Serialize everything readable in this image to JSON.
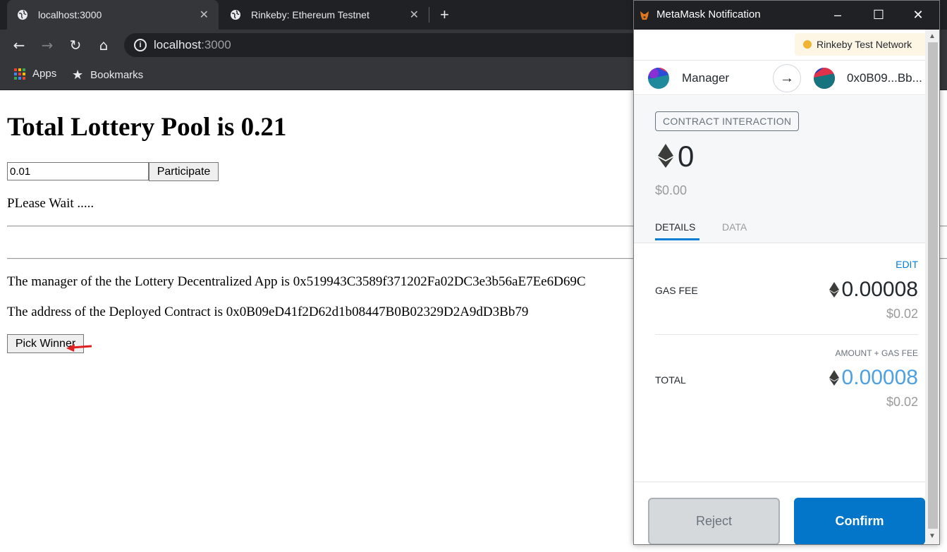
{
  "browser": {
    "tabs": [
      {
        "title": "localhost:3000",
        "active": true
      },
      {
        "title": "Rinkeby: Ethereum Testnet",
        "active": false
      }
    ],
    "address_bar": {
      "host": "localhost",
      "port": ":3000"
    },
    "bookmarks": [
      {
        "label": "Apps",
        "icon": "apps-grid-icon"
      },
      {
        "label": "Bookmarks",
        "icon": "star-icon"
      }
    ]
  },
  "page": {
    "pool_title": "Total Lottery Pool is 0.21",
    "amount_input_value": "0.01",
    "participate_label": "Participate",
    "wait_text": "PLease Wait .....",
    "manager_text": "The manager of the the Lottery Decentralized App is 0x519943C3589f371202Fa02DC3e3b56aE7Ee6D69C",
    "contract_text": "The address of the Deployed Contract is 0x0B09eD41f2D62d1b08447B0B02329D2A9dD3Bb79",
    "pick_winner_label": "Pick Winner"
  },
  "metamask": {
    "window_title": "MetaMask Notification",
    "network": "Rinkeby Test Network",
    "from_account": "Manager",
    "to_account": "0x0B09...Bb...",
    "badge": "CONTRACT INTERACTION",
    "amount": "0",
    "amount_fiat": "$0.00",
    "tabs": {
      "details": "DETAILS",
      "data": "DATA"
    },
    "edit_label": "EDIT",
    "gas_fee": {
      "label": "GAS FEE",
      "value": "0.00008",
      "fiat": "$0.02"
    },
    "amount_plus_gas_label": "AMOUNT + GAS FEE",
    "total": {
      "label": "TOTAL",
      "value": "0.00008",
      "fiat": "$0.02"
    },
    "reject_label": "Reject",
    "confirm_label": "Confirm"
  },
  "colors": {
    "metamask_blue": "#037dd6",
    "confirm_button": "#0376c9",
    "network_dot": "#f0b432",
    "chrome_dark": "#202124",
    "annotation_arrow": "#e02020"
  }
}
